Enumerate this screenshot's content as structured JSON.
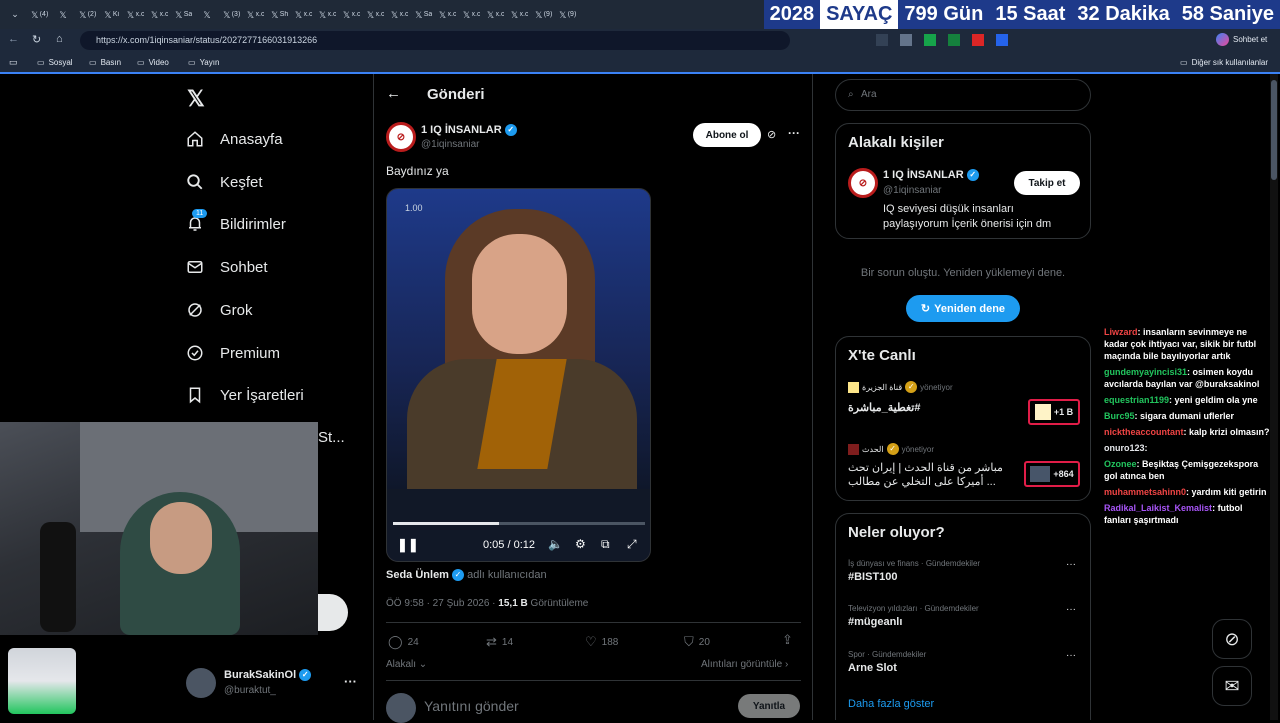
{
  "browser": {
    "tabs": [
      "(4)",
      "",
      "(2)",
      "Ki",
      "x.c",
      "x.c",
      "Sa",
      "",
      "(3)",
      "x.c",
      "Sh",
      "x.c",
      "x.c",
      "x.c",
      "x.c",
      "x.c",
      "Sa",
      "x.c",
      "x.c",
      "x.c",
      "x.c",
      "(9)",
      "(9)"
    ],
    "counter": {
      "year": "2028",
      "label": "SAYAÇ",
      "days": "799 Gün",
      "hours": "15 Saat",
      "minutes": "32 Dakika",
      "seconds": "58 Saniye"
    },
    "url": "https://x.com/1iqinsaniar/status/2027277166031913266",
    "chat_label": "Sohbet et",
    "bookmarks": [
      "Sosyal",
      "Basın",
      "Video",
      "Yayın"
    ],
    "other_bookmarks": "Diğer sık kullanılanlar"
  },
  "sidebar": {
    "items": [
      {
        "label": "Anasayfa",
        "icon": "home-icon"
      },
      {
        "label": "Keşfet",
        "icon": "search-icon"
      },
      {
        "label": "Bildirimler",
        "icon": "bell-icon",
        "badge": "11"
      },
      {
        "label": "Sohbet",
        "icon": "mail-icon"
      },
      {
        "label": "Grok",
        "icon": "grok-icon"
      },
      {
        "label": "Premium",
        "icon": "premium-icon"
      },
      {
        "label": "Yer İşaretleri",
        "icon": "bookmark-icon"
      },
      {
        "label": "St..."
      }
    ],
    "account": {
      "name": "BurakSakinOl",
      "handle": "@buraktut_"
    }
  },
  "post": {
    "header": "Gönderi",
    "author": {
      "name": "1 IQ İNSANLAR",
      "handle": "@1iqinsaniar"
    },
    "subscribe_label": "Abone ol",
    "text": "Baydınız ya",
    "video": {
      "time": "0:05 / 0:12",
      "badge": "1.00",
      "progress": 0.42
    },
    "credit_name": "Seda Ünlem",
    "credit_suffix": "adlı kullanıcıdan",
    "meta_time": "ÖÖ 9:58 · 27 Şub 2026 ·",
    "views_count": "15,1 B",
    "views_label": "Görüntüleme",
    "stats": {
      "replies": "24",
      "reposts": "14",
      "likes": "188",
      "bookmarks": "20"
    },
    "relevant_label": "Alakalı",
    "quotes_label": "Alıntıları görüntüle",
    "reply_placeholder": "Yanıtını gönder",
    "reply_button": "Yanıtla"
  },
  "right": {
    "search_placeholder": "Ara",
    "related": {
      "title": "Alakalı kişiler",
      "name": "1 IQ İNSANLAR",
      "handle": "@1iqinsaniar",
      "follow_label": "Takip et",
      "bio": "IQ seviyesi düşük insanları paylaşıyorum İçerik önerisi için dm"
    },
    "error_text": "Bir sorun oluştu. Yeniden yüklemeyi dene.",
    "retry_label": "Yeniden dene",
    "live": {
      "title": "X'te Canlı",
      "items": [
        {
          "source": "قناة الجزيرة",
          "role": "yönetiyor",
          "title": "تغطية_مباشرة#",
          "count": "+1 B"
        },
        {
          "source": "الحدث",
          "role": "yönetiyor",
          "title": "مباشر من قناة الحدث | إيران تحث أميركا على التخلي عن مطالب ...",
          "count": "+864"
        }
      ]
    },
    "trends": {
      "title": "Neler oluyor?",
      "items": [
        {
          "category": "İş dünyası ve finans · Gündemdekiler",
          "name": "#BIST100"
        },
        {
          "category": "Televizyon yıldızları · Gündemdekiler",
          "name": "#mügeanlı"
        },
        {
          "category": "Spor · Gündemdekiler",
          "name": "Arne Slot"
        }
      ],
      "more": "Daha fazla göster"
    }
  },
  "chat": [
    {
      "user": "Liwzard",
      "color": "#ef4444",
      "msg": "insanların sevinmeye ne kadar çok ihtiyacı var, sikik bir futbl maçında bile bayılıyorlar artık"
    },
    {
      "user": "gundemyayincisi31",
      "color": "#22c55e",
      "msg": "osimen koydu avcılarda bayılan var @buraksakinol"
    },
    {
      "user": "equestrian1199",
      "color": "#22c55e",
      "msg": "yeni geldim ola yne"
    },
    {
      "user": "Burc95",
      "color": "#22c55e",
      "msg": "sigara dumani uflerler"
    },
    {
      "user": "nicktheaccountant",
      "color": "#ef4444",
      "msg": "kalp krizi olmasın?"
    },
    {
      "user": "onuro123",
      "color": "#e5e7eb",
      "msg": ""
    },
    {
      "user": "Ozonee",
      "color": "#22c55e",
      "msg": "Beşiktaş Çemişgezekspora gol atınca ben"
    },
    {
      "user": "muhammetsahinn0",
      "color": "#ef4444",
      "msg": "yardım kiti getirin"
    },
    {
      "user": "Radikal_Laikist_Kemalist",
      "color": "#a855f7",
      "msg": "futbol fanları şaşırtmadı"
    }
  ],
  "colors": {
    "accent": "#1d9bf0",
    "counter_bg": "#1e3a8a"
  }
}
